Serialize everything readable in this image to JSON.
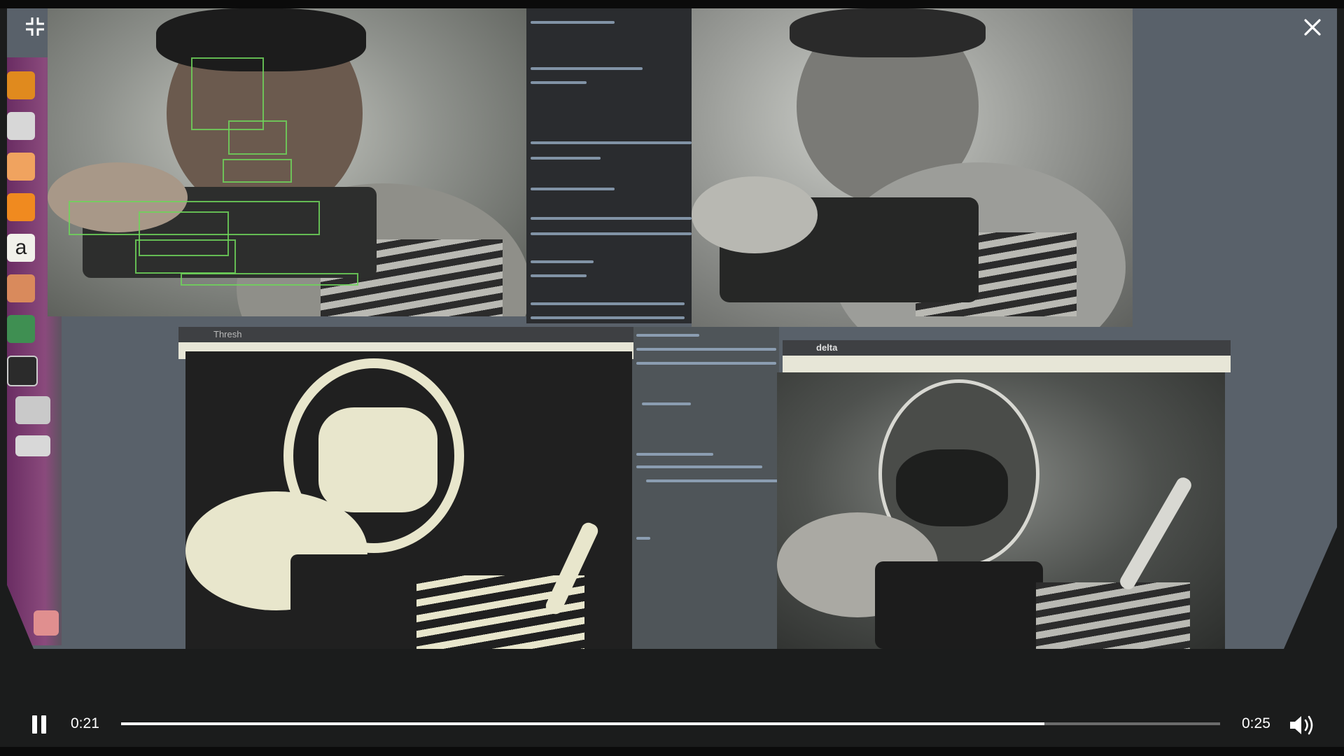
{
  "player": {
    "current_time": "0:21",
    "duration": "0:25",
    "progress_fraction": 0.84,
    "accent_color": "#ffffff",
    "icons": {
      "exit_fullscreen": "exit-fullscreen-icon",
      "close": "close-icon",
      "pause": "pause-icon",
      "volume": "volume-icon"
    }
  },
  "video_content": {
    "description_colors": {
      "launcher": "#7d3c73",
      "detection_box": "#6fd35a",
      "code_background": "#2a2c2f"
    },
    "window_titles": {
      "threshold_window": "Thresh",
      "delta_window": "delta"
    }
  }
}
